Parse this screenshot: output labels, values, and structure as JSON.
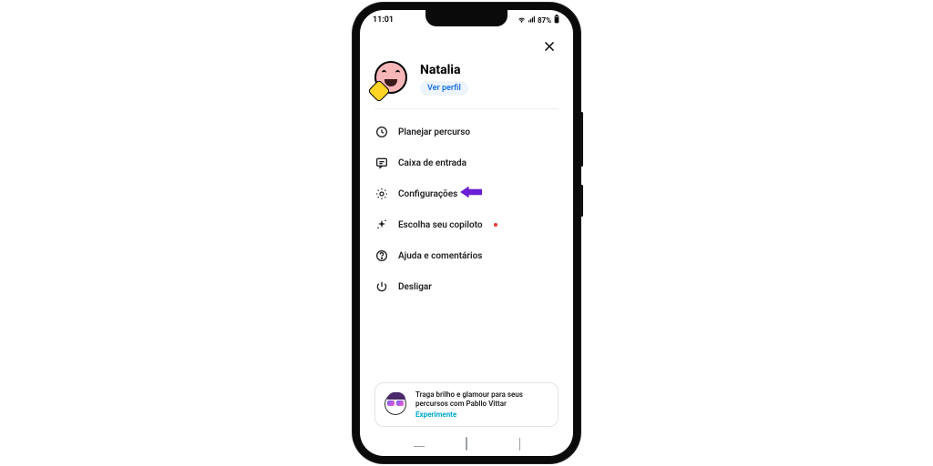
{
  "status": {
    "time": "11:01",
    "battery": "87%"
  },
  "profile": {
    "name": "Natalia",
    "view_profile": "Ver perfil"
  },
  "menu": {
    "plan_route": "Planejar percurso",
    "inbox": "Caixa de entrada",
    "settings": "Configurações",
    "copilot": "Escolha seu copiloto",
    "help": "Ajuda e comentários",
    "logout": "Desligar"
  },
  "promo": {
    "line1": "Traga brilho e glamour para seus",
    "line2": "percursos com Pabllo Vittar",
    "cta": "Experimente"
  },
  "annotation": {
    "arrow_color": "#6b1fd6"
  }
}
